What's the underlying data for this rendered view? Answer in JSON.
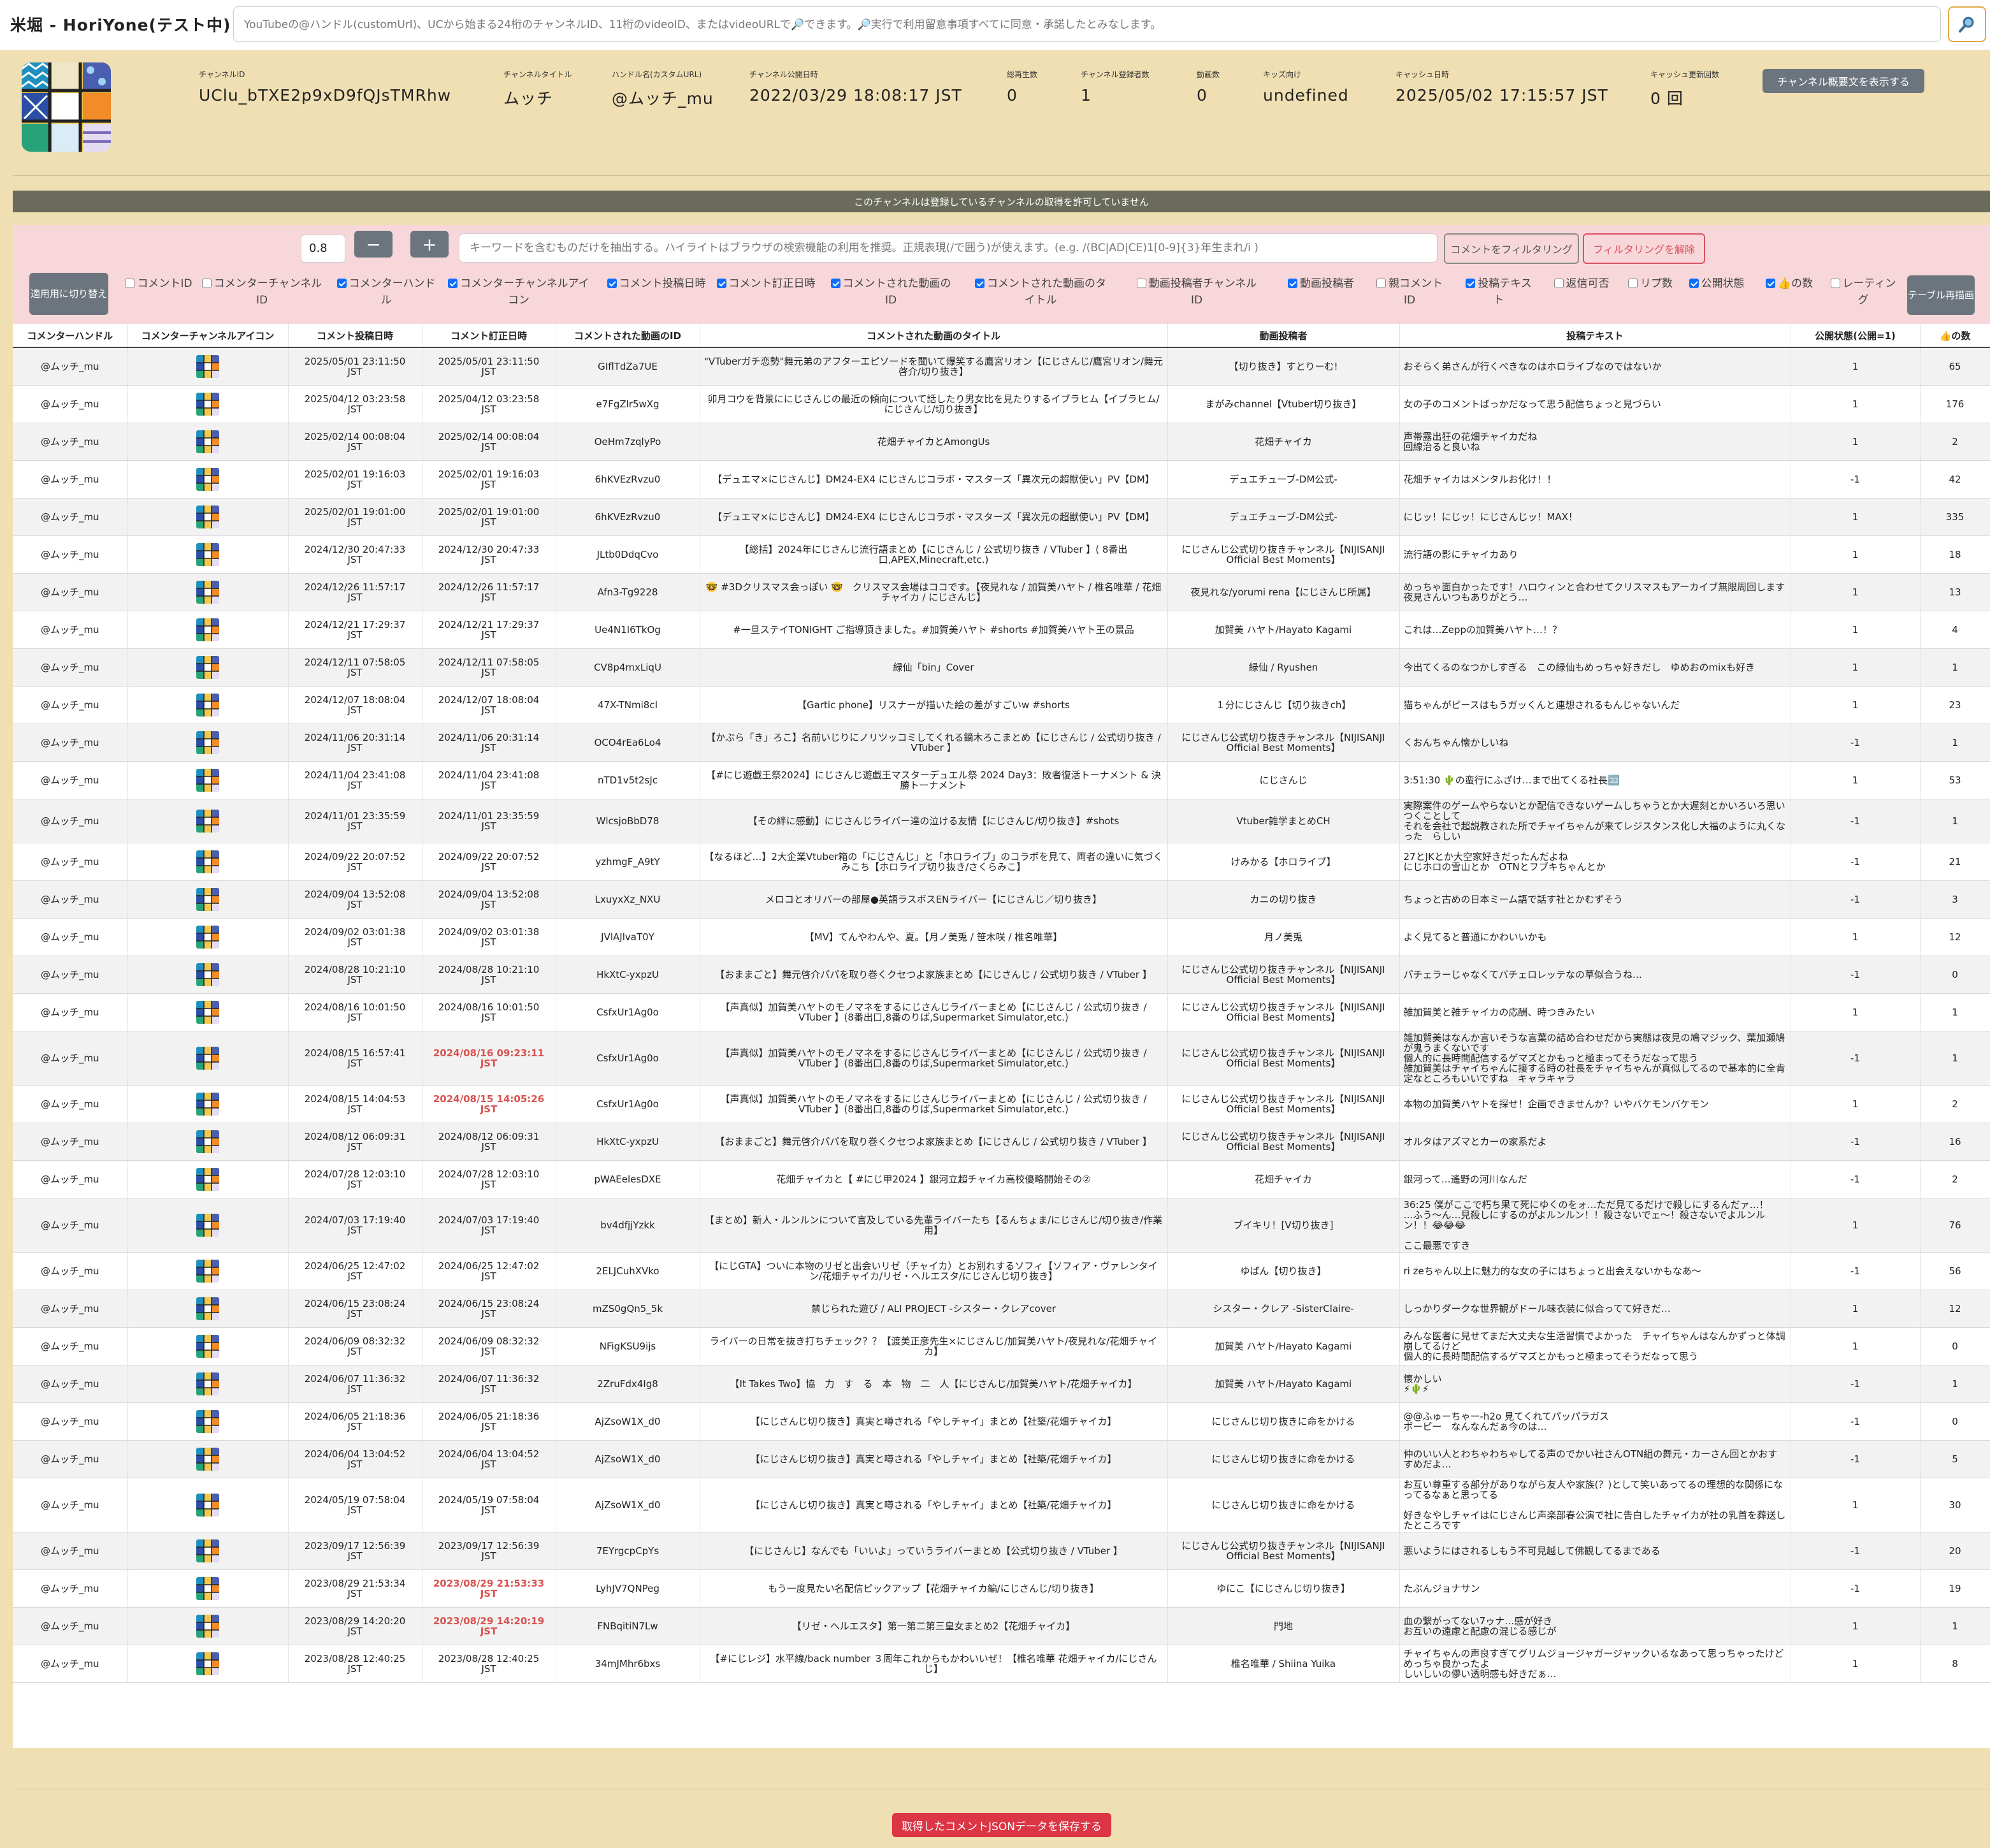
{
  "app": {
    "title": "米堀 - HoriYone(テスト中)"
  },
  "search": {
    "placeholder": "YouTubeの@ハンドル(customUrl)、UCから始まる24桁のチャンネルID、11桁のvideoID、またはvideoURLで🔎できます。🔎実行で利用留意事項すべてに同意・承諾したとみなします。"
  },
  "channel": {
    "fields": [
      {
        "label": "チャンネルID",
        "value": "UClu_bTXE2p9xD9fQJsTMRhw"
      },
      {
        "label": "チャンネルタイトル",
        "value": "ムッチ"
      },
      {
        "label": "ハンドル名(カスタムURL)",
        "value": "@ムッチ_mu"
      },
      {
        "label": "チャンネル公開日時",
        "value": "2022/03/29 18:08:17 JST"
      },
      {
        "label": "総再生数",
        "value": "0"
      },
      {
        "label": "チャンネル登録者数",
        "value": "1"
      },
      {
        "label": "動画数",
        "value": "0"
      },
      {
        "label": "キッズ向け",
        "value": "undefined"
      },
      {
        "label": "キャッシュ日時",
        "value": "2025/05/02 17:15:57 JST"
      },
      {
        "label": "キャッシュ更新回数",
        "value": "0 回"
      }
    ],
    "description_button": "チャンネル概要文を表示する",
    "notice": "このチャンネルは登録しているチャンネルの取得を許可していません"
  },
  "filter": {
    "zoom_value": "0.8",
    "minus": "−",
    "plus": "+",
    "keyword_placeholder": "キーワードを含むものだけを抽出する。ハイライトはブラウザの検索機能の利用を推奨。正規表現(/で囲う)が使えます。(e.g. /(BC|AD|CE)1[0-9]{3}年生まれ/i )",
    "filter_button": "コメントをフィルタリング",
    "clear_button": "フィルタリングを解除",
    "switch_button": "適用用に切り替え",
    "redraw_button": "テーブル再描画",
    "columns": [
      {
        "label": "コメントID",
        "checked": false
      },
      {
        "label": "コメンターチャンネルID",
        "checked": false
      },
      {
        "label": "コメンターハンドル",
        "checked": true
      },
      {
        "label": "コメンターチャンネルアイコン",
        "checked": true
      },
      {
        "label": "コメント投稿日時",
        "checked": true
      },
      {
        "label": "コメント訂正日時",
        "checked": true
      },
      {
        "label": "コメントされた動画のID",
        "checked": true
      },
      {
        "label": "コメントされた動画のタイトル",
        "checked": true
      },
      {
        "label": "動画投稿者チャンネルID",
        "checked": false
      },
      {
        "label": "動画投稿者",
        "checked": true
      },
      {
        "label": "親コメントID",
        "checked": false
      },
      {
        "label": "投稿テキスト",
        "checked": true
      },
      {
        "label": "返信可否",
        "checked": false
      },
      {
        "label": "リプ数",
        "checked": false
      },
      {
        "label": "公開状態",
        "checked": true
      },
      {
        "label": "👍の数",
        "checked": true
      },
      {
        "label": "レーティング",
        "checked": false
      }
    ]
  },
  "table": {
    "headers": [
      "コメンターハンドル",
      "コメンターチャンネルアイコン",
      "コメント投稿日時",
      "コメント訂正日時",
      "コメントされた動画のID",
      "コメントされた動画のタイトル",
      "動画投稿者",
      "投稿テキスト",
      "公開状態(公開=1)",
      "👍の数"
    ],
    "rows": [
      {
        "handle": "@ムッチ_mu",
        "posted": "2025/05/01 23:11:50",
        "edited": "2025/05/01 23:11:50",
        "edited_flag": false,
        "video_id": "GIflTdZa7UE",
        "video_title": "\"VTuberガチ恋勢\"舞元弟のアフターエピソードを聞いて爆笑する鷹宮リオン【にじさんじ/鷹宮リオン/舞元啓介/切り抜き】",
        "uploader": "【切り抜き】すとりーむ!",
        "text": "おそらく弟さんが行くべきなのはホロライブなのではないか",
        "status": "1",
        "likes": "65"
      },
      {
        "handle": "@ムッチ_mu",
        "posted": "2025/04/12 03:23:58",
        "edited": "2025/04/12 03:23:58",
        "edited_flag": false,
        "video_id": "e7FgZlr5wXg",
        "video_title": "卯月コウを背景ににじさんじの最近の傾向について話したり男女比を見たりするイブラヒム【イブラヒム/にじさんじ/切り抜き】",
        "uploader": "まがみchannel【Vtuber切り抜き】",
        "text": "女の子のコメントばっかだなって思う配信ちょっと見づらい",
        "status": "1",
        "likes": "176"
      },
      {
        "handle": "@ムッチ_mu",
        "posted": "2025/02/14 00:08:04",
        "edited": "2025/02/14 00:08:04",
        "edited_flag": false,
        "video_id": "OeHm7zqlyPo",
        "video_title": "花畑チャイカとAmongUs",
        "uploader": "花畑チャイカ",
        "text": "声帯露出狂の花畑チャイカだね\n回線治ると良いね",
        "status": "1",
        "likes": "2"
      },
      {
        "handle": "@ムッチ_mu",
        "posted": "2025/02/01 19:16:03",
        "edited": "2025/02/01 19:16:03",
        "edited_flag": false,
        "video_id": "6hKVEzRvzu0",
        "video_title": "【デュエマ×にじさんじ】DM24-EX4 にじさんじコラボ・マスターズ「異次元の超獣使い」PV【DM】",
        "uploader": "デュエチューブ-DM公式-",
        "text": "花畑チャイカはメンタルお化け！！",
        "status": "-1",
        "likes": "42"
      },
      {
        "handle": "@ムッチ_mu",
        "posted": "2025/02/01 19:01:00",
        "edited": "2025/02/01 19:01:00",
        "edited_flag": false,
        "video_id": "6hKVEzRvzu0",
        "video_title": "【デュエマ×にじさんじ】DM24-EX4 にじさんじコラボ・マスターズ「異次元の超獣使い」PV【DM】",
        "uploader": "デュエチューブ-DM公式-",
        "text": "にじッ！にじッ！にじさんじッ！MAX！",
        "status": "1",
        "likes": "335"
      },
      {
        "handle": "@ムッチ_mu",
        "posted": "2024/12/30 20:47:33",
        "edited": "2024/12/30 20:47:33",
        "edited_flag": false,
        "video_id": "JLtb0DdqCvo",
        "video_title": "【総括】2024年にじさんじ流行語まとめ【にじさんじ / 公式切り抜き / VTuber 】( 8番出口,APEX,Minecraft,etc.)",
        "uploader": "にじさんじ公式切り抜きチャンネル【NIJISANJI Official Best Moments】",
        "text": "流行語の影にチャイカあり",
        "status": "1",
        "likes": "18"
      },
      {
        "handle": "@ムッチ_mu",
        "posted": "2024/12/26 11:57:17",
        "edited": "2024/12/26 11:57:17",
        "edited_flag": false,
        "video_id": "Afn3-Tg9228",
        "video_title": "🤓 #3Dクリスマス会っぽい 🤓　クリスマス会場はココです。【夜見れな / 加賀美ハヤト / 椎名唯華 / 花畑チャイカ / にじさんじ】",
        "uploader": "夜見れな/yorumi rena【にじさんじ所属】",
        "text": "めっちゃ面白かったです！ハロウィンと合わせてクリスマスもアーカイブ無限周回します\n夜見さんいつもありがとう…",
        "status": "1",
        "likes": "13"
      },
      {
        "handle": "@ムッチ_mu",
        "posted": "2024/12/21 17:29:37",
        "edited": "2024/12/21 17:29:37",
        "edited_flag": false,
        "video_id": "Ue4N1I6TkOg",
        "video_title": "#一旦ステイTONIGHT ご指導頂きました。#加賀美ハヤト #shorts #加賀美ハヤト王の景品",
        "uploader": "加賀美 ハヤト/Hayato Kagami",
        "text": "これは…Zeppの加賀美ハヤト…！？",
        "status": "1",
        "likes": "4"
      },
      {
        "handle": "@ムッチ_mu",
        "posted": "2024/12/11 07:58:05",
        "edited": "2024/12/11 07:58:05",
        "edited_flag": false,
        "video_id": "CV8p4mxLiqU",
        "video_title": "緑仙「bin」Cover",
        "uploader": "緑仙 / Ryushen",
        "text": "今出てくるのなつかしすぎる　この緑仙もめっちゃ好きだし　ゆめおのmixも好き",
        "status": "1",
        "likes": "1"
      },
      {
        "handle": "@ムッチ_mu",
        "posted": "2024/12/07 18:08:04",
        "edited": "2024/12/07 18:08:04",
        "edited_flag": false,
        "video_id": "47X-TNmi8cI",
        "video_title": "【Gartic phone】リスナーが描いた絵の差がすごいw #shorts",
        "uploader": "１分にじさんじ【切り抜きch】",
        "text": "猫ちゃんがピースはもうガッくんと連想されるもんじゃないんだ",
        "status": "1",
        "likes": "23"
      },
      {
        "handle": "@ムッチ_mu",
        "posted": "2024/11/06 20:31:14",
        "edited": "2024/11/06 20:31:14",
        "edited_flag": false,
        "video_id": "OCO4rEa6Lo4",
        "video_title": "【かぶら「き」ろこ】名前いじりにノリツッコミしてくれる鏑木ろこまとめ【にじさんじ / 公式切り抜き / VTuber 】",
        "uploader": "にじさんじ公式切り抜きチャンネル【NIJISANJI Official Best Moments】",
        "text": "くおんちゃん懐かしいね",
        "status": "-1",
        "likes": "1"
      },
      {
        "handle": "@ムッチ_mu",
        "posted": "2024/11/04 23:41:08",
        "edited": "2024/11/04 23:41:08",
        "edited_flag": false,
        "video_id": "nTD1v5t2sJc",
        "video_title": "【#にじ遊戯王祭2024】にじさんじ遊戯王マスターデュエル祭 2024 Day3：敗者復活トーナメント & 決勝トーナメント",
        "uploader": "にじさんじ",
        "text": "3:51:30 🌵の蛮行にふざけ…まで出てくる社長🈁",
        "status": "1",
        "likes": "53"
      },
      {
        "handle": "@ムッチ_mu",
        "posted": "2024/11/01 23:35:59",
        "edited": "2024/11/01 23:35:59",
        "edited_flag": false,
        "video_id": "WlcsjoBbD78",
        "video_title": "【その絆に感動】にじさんじライバー達の泣ける友情【にじさんじ/切り抜き】#shots",
        "uploader": "Vtuber雑学まとめCH",
        "text": "実際案件のゲームやらないとか配信できないゲームしちゃうとか大遅刻とかいろいろ思いつくことして\nそれを会社で超説教された所でチャイちゃんが来てレジスタンス化し大福のように丸くなった　らしい",
        "status": "-1",
        "likes": "1"
      },
      {
        "handle": "@ムッチ_mu",
        "posted": "2024/09/22 20:07:52",
        "edited": "2024/09/22 20:07:52",
        "edited_flag": false,
        "video_id": "yzhmgF_A9tY",
        "video_title": "【なるほど…】2大企業Vtuber箱の「にじさんじ」と「ホロライブ」のコラボを見て、両者の違いに気づくみこち【ホロライブ切り抜き/さくらみこ】",
        "uploader": "けみかる【ホロライブ】",
        "text": "27とJKとか大空家好きだったんだよね\nにじホロの雪山とか　OTNとフブキちゃんとか",
        "status": "-1",
        "likes": "21"
      },
      {
        "handle": "@ムッチ_mu",
        "posted": "2024/09/04 13:52:08",
        "edited": "2024/09/04 13:52:08",
        "edited_flag": false,
        "video_id": "LxuyxXz_NXU",
        "video_title": "メロコとオリバーの部屋●英語ラスボスENライバー【にじさんじ／切り抜き】",
        "uploader": "カニの切り抜き",
        "text": "ちょっと古めの日本ミーム語で話す社とかむずそう",
        "status": "-1",
        "likes": "3"
      },
      {
        "handle": "@ムッチ_mu",
        "posted": "2024/09/02 03:01:38",
        "edited": "2024/09/02 03:01:38",
        "edited_flag": false,
        "video_id": "JVlAJlvaT0Y",
        "video_title": "【MV】てんやわんや、夏。【月ノ美兎 / 笹木咲 / 椎名唯華】",
        "uploader": "月ノ美兎",
        "text": "よく見てると普通にかわいいかも",
        "status": "1",
        "likes": "12"
      },
      {
        "handle": "@ムッチ_mu",
        "posted": "2024/08/28 10:21:10",
        "edited": "2024/08/28 10:21:10",
        "edited_flag": false,
        "video_id": "HkXtC-yxpzU",
        "video_title": "【おままごと】舞元啓介パパを取り巻くクセつよ家族まとめ【にじさんじ / 公式切り抜き / VTuber 】",
        "uploader": "にじさんじ公式切り抜きチャンネル【NIJISANJI Official Best Moments】",
        "text": "パチェラーじゃなくてバチェロレッテなの草似合うね…",
        "status": "-1",
        "likes": "0"
      },
      {
        "handle": "@ムッチ_mu",
        "posted": "2024/08/16 10:01:50",
        "edited": "2024/08/16 10:01:50",
        "edited_flag": false,
        "video_id": "CsfxUr1Ag0o",
        "video_title": "【声真似】加賀美ハヤトのモノマネをするにじさんじライバーまとめ【にじさんじ / 公式切り抜き / VTuber 】(8番出口,8番のりば,Supermarket Simulator,etc.)",
        "uploader": "にじさんじ公式切り抜きチャンネル【NIJISANJI Official Best Moments】",
        "text": "雑加賀美と雑チャイカの応酬、時つきみたい",
        "status": "1",
        "likes": "1"
      },
      {
        "handle": "@ムッチ_mu",
        "posted": "2024/08/15 16:57:41",
        "edited": "2024/08/16 09:23:11",
        "edited_flag": true,
        "video_id": "CsfxUr1Ag0o",
        "video_title": "【声真似】加賀美ハヤトのモノマネをするにじさんじライバーまとめ【にじさんじ / 公式切り抜き / VTuber 】(8番出口,8番のりば,Supermarket Simulator,etc.)",
        "uploader": "にじさんじ公式切り抜きチャンネル【NIJISANJI Official Best Moments】",
        "text": "雑加賀美はなんか言いそうな言葉の詰め合わせだから実態は夜見の鳩マジック、葉加瀬鳩が鬼うまくないです\n個人的に長時間配信するゲマズとかもっと極まってそうだなって思う\n雑加賀美はチャイちゃんに接する時の社長をチャイちゃんが真似してるので基本的に全肯定なところもいいですね　キャラキャラ",
        "status": "-1",
        "likes": "1"
      },
      {
        "handle": "@ムッチ_mu",
        "posted": "2024/08/15 14:04:53",
        "edited": "2024/08/15 14:05:26",
        "edited_flag": true,
        "video_id": "CsfxUr1Ag0o",
        "video_title": "【声真似】加賀美ハヤトのモノマネをするにじさんじライバーまとめ【にじさんじ / 公式切り抜き / VTuber 】(8番出口,8番のりば,Supermarket Simulator,etc.)",
        "uploader": "にじさんじ公式切り抜きチャンネル【NIJISANJI Official Best Moments】",
        "text": "本物の加賀美ハヤトを探せ！企画できませんか？いやバケモンバケモン",
        "status": "1",
        "likes": "2"
      },
      {
        "handle": "@ムッチ_mu",
        "posted": "2024/08/12 06:09:31",
        "edited": "2024/08/12 06:09:31",
        "edited_flag": false,
        "video_id": "HkXtC-yxpzU",
        "video_title": "【おままごと】舞元啓介パパを取り巻くクセつよ家族まとめ【にじさんじ / 公式切り抜き / VTuber 】",
        "uploader": "にじさんじ公式切り抜きチャンネル【NIJISANJI Official Best Moments】",
        "text": "オルタはアズマとカーの家系だよ",
        "status": "-1",
        "likes": "16"
      },
      {
        "handle": "@ムッチ_mu",
        "posted": "2024/07/28 12:03:10",
        "edited": "2024/07/28 12:03:10",
        "edited_flag": false,
        "video_id": "pWAEelesDXE",
        "video_title": "花畑チャイカと【 #にじ甲2024 】銀河立超チャイカ高校優略開始その②",
        "uploader": "花畑チャイカ",
        "text": "銀河って…遙野の河川なんだ",
        "status": "-1",
        "likes": "2"
      },
      {
        "handle": "@ムッチ_mu",
        "posted": "2024/07/03 17:19:40",
        "edited": "2024/07/03 17:19:40",
        "edited_flag": false,
        "video_id": "bv4dfjjYzkk",
        "video_title": "【まとめ】新人・ルンルンについて言及している先輩ライバーたち【るんちょま/にじさんじ/切り抜き/作業用】",
        "uploader": "ブイキリ！[V切り抜き]",
        "text": "36:25 僕がここで朽ち果て死にゆくのをォ…ただ見てるだけで殺しにするんだァ…！\n…ふう～ん…見殺しにするのがよルンルン！！殺さないでェ～！殺さないでよルンルン！！😂😂😂\n\nここ最悪ですき",
        "status": "1",
        "likes": "76"
      },
      {
        "handle": "@ムッチ_mu",
        "posted": "2024/06/25 12:47:02",
        "edited": "2024/06/25 12:47:02",
        "edited_flag": false,
        "video_id": "2ELJCuhXVko",
        "video_title": "【にじGTA】ついに本物のリゼと出会いリゼ（チャイカ）とお別れするソフィ【ソフィア・ヴァレンタイン/花畑チャイカ/リゼ・ヘルエスタ/にじさんじ切り抜き】",
        "uploader": "ゆばん【切り抜き】",
        "text": "ri zeちゃん以上に魅力的な女の子にはちょっと出会えないかもなあ～",
        "status": "-1",
        "likes": "56"
      },
      {
        "handle": "@ムッチ_mu",
        "posted": "2024/06/15 23:08:24",
        "edited": "2024/06/15 23:08:24",
        "edited_flag": false,
        "video_id": "mZS0gQn5_5k",
        "video_title": "禁じられた遊び / ALI PROJECT -シスター・クレアcover",
        "uploader": "シスター・クレア -SisterClaire-",
        "text": "しっかりダークな世界観がドール味衣装に似合ってて好きだ…",
        "status": "1",
        "likes": "12"
      },
      {
        "handle": "@ムッチ_mu",
        "posted": "2024/06/09 08:32:32",
        "edited": "2024/06/09 08:32:32",
        "edited_flag": false,
        "video_id": "NFigKSU9ijs",
        "video_title": "ライバーの日常を抜き打ちチェック？？【渡美正彦先生×にじさんじ/加賀美ハヤト/夜見れな/花畑チャイカ】",
        "uploader": "加賀美 ハヤト/Hayato Kagami",
        "text": "みんな医者に見せてまだ大丈夫な生活習慣でよかった　チャイちゃんはなんかずっと体調崩してるけど\n個人的に長時間配信するゲマズとかもっと極まってそうだなって思う",
        "status": "1",
        "likes": "0"
      },
      {
        "handle": "@ムッチ_mu",
        "posted": "2024/06/07 11:36:32",
        "edited": "2024/06/07 11:36:32",
        "edited_flag": false,
        "video_id": "2ZruFdx4Ig8",
        "video_title": "【It Takes Two】協　力　す　る　本　物　二　人【にじさんじ/加賀美ハヤト/花畑チャイカ】",
        "uploader": "加賀美 ハヤト/Hayato Kagami",
        "text": "懐かしい\n⚡🌵⚡",
        "status": "-1",
        "likes": "1"
      },
      {
        "handle": "@ムッチ_mu",
        "posted": "2024/06/05 21:18:36",
        "edited": "2024/06/05 21:18:36",
        "edited_flag": false,
        "video_id": "AjZsoW1X_d0",
        "video_title": "【にじさんじ切り抜き】真実と噂される「やしチャイ」まとめ【社築/花畑チャイカ】",
        "uploader": "にじさんじ切り抜きに命をかける",
        "text": "@@ふゅーちゃー-h2o 見てくれてパッパラガス\nボーピー　なんなんだぁ今のは…",
        "status": "-1",
        "likes": "0"
      },
      {
        "handle": "@ムッチ_mu",
        "posted": "2024/06/04 13:04:52",
        "edited": "2024/06/04 13:04:52",
        "edited_flag": false,
        "video_id": "AjZsoW1X_d0",
        "video_title": "【にじさんじ切り抜き】真実と噂される「やしチャイ」まとめ【社築/花畑チャイカ】",
        "uploader": "にじさんじ切り抜きに命をかける",
        "text": "仲のいい人とわちゃわちゃしてる声のでかい社さんOTN組の舞元・カーさん回とかおすすめだよ…",
        "status": "-1",
        "likes": "5"
      },
      {
        "handle": "@ムッチ_mu",
        "posted": "2024/05/19 07:58:04",
        "edited": "2024/05/19 07:58:04",
        "edited_flag": false,
        "video_id": "AjZsoW1X_d0",
        "video_title": "【にじさんじ切り抜き】真実と噂される「やしチャイ」まとめ【社築/花畑チャイカ】",
        "uploader": "にじさんじ切り抜きに命をかける",
        "text": "お互い尊重する部分がありながら友人や家族(？)として笑いあってるの理想的な関係になってるなぁと思ってる\n\n好きなやしチャイはにじさんじ声楽部春公演で社に告白したチャイカが社の乳首を葬送したところです",
        "status": "1",
        "likes": "30"
      },
      {
        "handle": "@ムッチ_mu",
        "posted": "2023/09/17 12:56:39",
        "edited": "2023/09/17 12:56:39",
        "edited_flag": false,
        "video_id": "7EYrgcpCpYs",
        "video_title": "【にじさんじ】なんでも「いいよ」っていうライバーまとめ【公式切り抜き / VTuber 】",
        "uploader": "にじさんじ公式切り抜きチャンネル【NIJISANJI Official Best Moments】",
        "text": "悪いようにはされるしもう不可見越して佛観してるまである",
        "status": "-1",
        "likes": "20"
      },
      {
        "handle": "@ムッチ_mu",
        "posted": "2023/08/29 21:53:34",
        "edited": "2023/08/29 21:53:33",
        "edited_flag": true,
        "video_id": "LyhJV7QNPeg",
        "video_title": "もう一度見たい名配信ピックアップ【花畑チャイカ編/にじさんじ/切り抜き】",
        "uploader": "ゆにこ【にじさんじ切り抜き】",
        "text": "たぶんジョナサン",
        "status": "-1",
        "likes": "19"
      },
      {
        "handle": "@ムッチ_mu",
        "posted": "2023/08/29 14:20:20",
        "edited": "2023/08/29 14:20:19",
        "edited_flag": true,
        "video_id": "FNBqitiN7Lw",
        "video_title": "【リゼ・ヘルエスタ】第一第二第三皇女まとめ2【花畑チャイカ】",
        "uploader": "門地",
        "text": "血の繋がってない7ゥナ…感が好き\nお互いの遠慮と配慮の混じる感じが",
        "status": "1",
        "likes": "1"
      },
      {
        "handle": "@ムッチ_mu",
        "posted": "2023/08/28 12:40:25",
        "edited": "2023/08/28 12:40:25",
        "edited_flag": false,
        "video_id": "34mJMhr6bxs",
        "video_title": "【#にじレジ】水平線/back number ３周年これからもかわいいぜ！【椎名唯華 花畑チャイカ/にじさんじ】",
        "uploader": "椎名唯華 / Shiina Yuika",
        "text": "チャイちゃんの声良すぎてグリムジョージャガージャックいるなあって思っちゃったけどめっちゃ良かったよ\nしいしいの儚い透明感も好きだぁ…",
        "status": "1",
        "likes": "8"
      }
    ],
    "tz_suffix": "JST"
  },
  "save_button": "取得したコメントJSONデータを保存する"
}
